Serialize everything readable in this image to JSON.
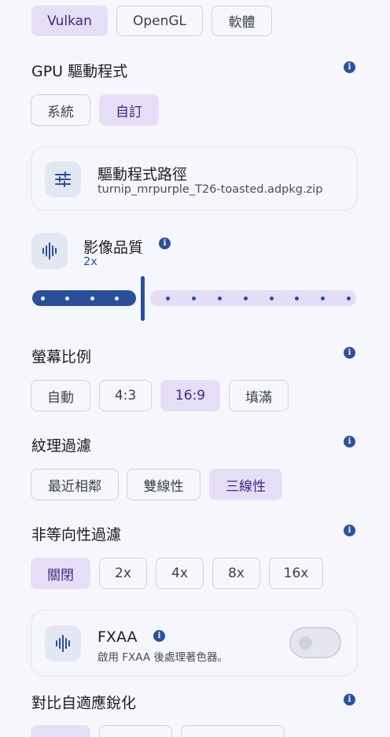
{
  "renderer_tabs": [
    {
      "label": "Vulkan",
      "selected": true
    },
    {
      "label": "OpenGL",
      "selected": false
    },
    {
      "label": "軟體",
      "selected": false
    }
  ],
  "gpu_driver": {
    "title": "GPU 驅動程式",
    "options": [
      {
        "label": "系統",
        "selected": false
      },
      {
        "label": "自訂",
        "selected": true
      }
    ],
    "path_card": {
      "title": "驅動程式路徑",
      "value": "turnip_mrpurple_T26-toasted.adpkg.zip",
      "icon": "sliders-icon"
    }
  },
  "image_quality": {
    "title": "影像品質",
    "value": "2x",
    "icon": "waveform-icon",
    "slider_fraction": 0.34
  },
  "aspect_ratio": {
    "title": "螢幕比例",
    "options": [
      {
        "label": "自動",
        "selected": false
      },
      {
        "label": "4:3",
        "selected": false
      },
      {
        "label": "16:9",
        "selected": true
      },
      {
        "label": "填滿",
        "selected": false
      }
    ]
  },
  "texture_filter": {
    "title": "紋理過濾",
    "options": [
      {
        "label": "最近相鄰",
        "selected": false
      },
      {
        "label": "雙線性",
        "selected": false
      },
      {
        "label": "三線性",
        "selected": true
      }
    ]
  },
  "anisotropic_filter": {
    "title": "非等向性過濾",
    "options": [
      {
        "label": "關閉",
        "selected": true
      },
      {
        "label": "2x",
        "selected": false
      },
      {
        "label": "4x",
        "selected": false
      },
      {
        "label": "8x",
        "selected": false
      },
      {
        "label": "16x",
        "selected": false
      }
    ]
  },
  "fxaa": {
    "title": "FXAA",
    "description": "啟用 FXAA 後處理著色器。",
    "icon": "waveform-icon",
    "enabled": false
  },
  "adaptive_sharpen": {
    "title": "對比自適應銳化"
  },
  "info_icon_label": "i",
  "colors": {
    "accent": "#2a4f98",
    "selected_chip": "#e6def7",
    "background": "#f6f7fc"
  }
}
